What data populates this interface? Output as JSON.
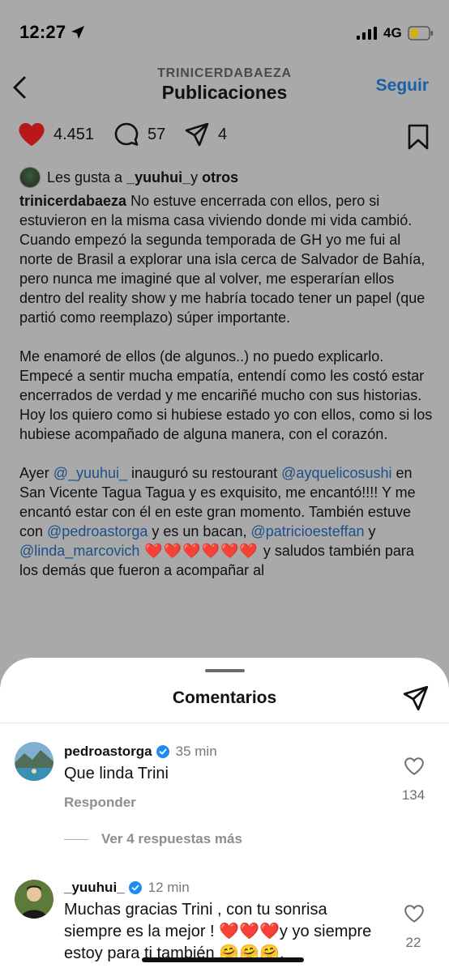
{
  "status_bar": {
    "time": "12:27",
    "network": "4G"
  },
  "nav": {
    "username": "TRINICERDABAEZA",
    "title": "Publicaciones",
    "follow_label": "Seguir"
  },
  "actions": {
    "likes_count": "4.451",
    "comments_count": "57",
    "shares_count": "4"
  },
  "likes_line": {
    "prefix": "Les gusta a ",
    "user": "_yuuhui_",
    "connector": " y ",
    "others": "otros"
  },
  "caption": {
    "author": "trinicerdabaeza",
    "p1": " No estuve encerrada con ellos, pero si estuvieron en la misma casa viviendo donde mi vida cambió. Cuando empezó la segunda temporada de GH yo me fui al norte de Brasil a explorar una isla cerca de Salvador de Bahía, pero nunca me imaginé que al volver, me esperarían ellos dentro del reality show y me habría tocado tener un papel (que partió como reemplazo) súper importante.",
    "p2": "Me enamoré de ellos (de algunos..) no puedo explicarlo. Empecé a sentir mucha empatía, entendí como les costó estar encerrados de verdad y me encariñé mucho con sus historias. Hoy los quiero como si hubiese estado yo con ellos, como si los hubiese acompañado de alguna manera, con el corazón.",
    "p3_a": "Ayer ",
    "m1": "@_yuuhui_",
    "p3_b": " inauguró su restourant ",
    "m2": "@ayquelicosushi",
    "p3_c": " en San Vicente Tagua Tagua y es exquisito, me encantó!!!! Y me encantó estar con él en este gran momento. También estuve con ",
    "m3": "@pedroastorga",
    "p3_d": " y es un bacan, ",
    "m4": "@patricioesteffan",
    "p3_e": " y ",
    "m5": "@linda_marcovich",
    "hearts": " ❤️❤️❤️❤️❤️❤️ ",
    "p3_f": " y saludos también para los demás que fueron a acompañar al"
  },
  "sheet": {
    "title": "Comentarios"
  },
  "comments": [
    {
      "user": "pedroastorga",
      "time": "35 min",
      "text": "Que linda Trini",
      "reply_label": "Responder",
      "likes": "134",
      "more_replies": "Ver 4 respuestas más"
    },
    {
      "user": "_yuuhui_",
      "time": "12 min",
      "text_a": "Muchas gracias Trini , con tu sonrisa siempre es la mejor ! ",
      "hearts": "❤️❤️❤️",
      "text_b": "y yo siempre estoy para ti también ",
      "emojis": "🤗🤗🤗",
      "text_c": ".",
      "likes": "22"
    }
  ]
}
